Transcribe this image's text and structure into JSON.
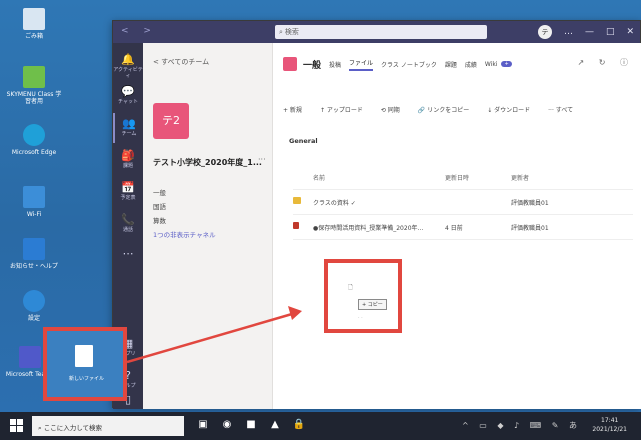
{
  "desktop": {
    "icons": [
      {
        "label": "ごみ箱",
        "color": "#d9e6f2"
      },
      {
        "label": "SKYMENU Class 学習者用",
        "color": "#6fbf4a"
      },
      {
        "label": "Microsoft Edge",
        "color": "#1fa0d8"
      },
      {
        "label": "Wi-Fi",
        "color": "#3c8ed8"
      },
      {
        "label": "お知らせ・ヘルプ",
        "color": "#2b7cd3"
      },
      {
        "label": "設定",
        "color": "#2e89d6"
      },
      {
        "label": "Microsoft Teams",
        "color": "#5059c9"
      }
    ]
  },
  "window": {
    "nav_arrows": "< >",
    "search_placeholder": "検索",
    "avatar_initial": "テ",
    "controls": [
      "…",
      "—",
      "□",
      "✕"
    ]
  },
  "rail": {
    "items": [
      {
        "label": "アクティビティ",
        "icon": "bell-icon",
        "glyph": "🔔"
      },
      {
        "label": "チャット",
        "icon": "chat-icon",
        "glyph": "💬"
      },
      {
        "label": "チーム",
        "icon": "teams-icon",
        "glyph": "👥"
      },
      {
        "label": "課題",
        "icon": "assignments-icon",
        "glyph": "🎒"
      },
      {
        "label": "予定表",
        "icon": "calendar-icon",
        "glyph": "📅"
      },
      {
        "label": "通話",
        "icon": "phone-icon",
        "glyph": "📞"
      },
      {
        "label": "…",
        "icon": "more-icon",
        "glyph": "⋯"
      },
      {
        "label": "アプリ",
        "icon": "apps-icon",
        "glyph": "▦"
      },
      {
        "label": "ヘルプ",
        "icon": "help-icon",
        "glyph": "?"
      },
      {
        "label": "",
        "icon": "device-icon",
        "glyph": "▯"
      }
    ]
  },
  "team": {
    "back_label": "< すべてのチーム",
    "tile_text": "テ2",
    "name": "テスト小学校_2020年度_1...",
    "more": "···",
    "channels": [
      "一般",
      "国語",
      "算数",
      "1つの非表示チャネル"
    ]
  },
  "channel": {
    "title": "一般",
    "tabs": [
      "投稿",
      "ファイル",
      "クラス ノートブック",
      "課題",
      "成績"
    ],
    "active_tab": "ファイル",
    "extra_tab": "Wiki",
    "extra_badge": "+",
    "header_icons": "↗ ↻ ⓘ",
    "toolbar": [
      "+ 新規",
      "↑ アップロード",
      "⟲ 同期",
      "🔗 リンクをコピー",
      "↓ ダウンロード",
      "··· すべて"
    ],
    "section": "General",
    "columns": {
      "name": "名前",
      "modified": "更新日時",
      "modified_by": "更新者"
    },
    "files": [
      {
        "name": "クラスの資料 ✓",
        "modified": "",
        "modified_by": "評価教職員01",
        "type": "folder"
      },
      {
        "name": "●保存時間活用資料_授業準備_2020年...",
        "modified": "4 日前",
        "modified_by": "評価教職員01",
        "type": "doc"
      }
    ]
  },
  "drag": {
    "ghost": "🗋",
    "copy_label": "+ コピー",
    "hint": "· ·"
  },
  "source": {
    "file_label": "新しいファイル"
  },
  "taskbar": {
    "search_placeholder": "ここに入力して検索",
    "apps": [
      "▣",
      "◉",
      "■",
      "▲",
      "🔒"
    ],
    "tray": "^ ▭ ◆ ♪ ⌨ ✎ あ",
    "time": "17:41",
    "date": "2021/12/21"
  },
  "colors": {
    "accent": "#5b5fc7",
    "team_tile": "#e8557a",
    "highlight": "#e1473f",
    "rail": "#33344a",
    "titlebar": "#3d3e66"
  }
}
